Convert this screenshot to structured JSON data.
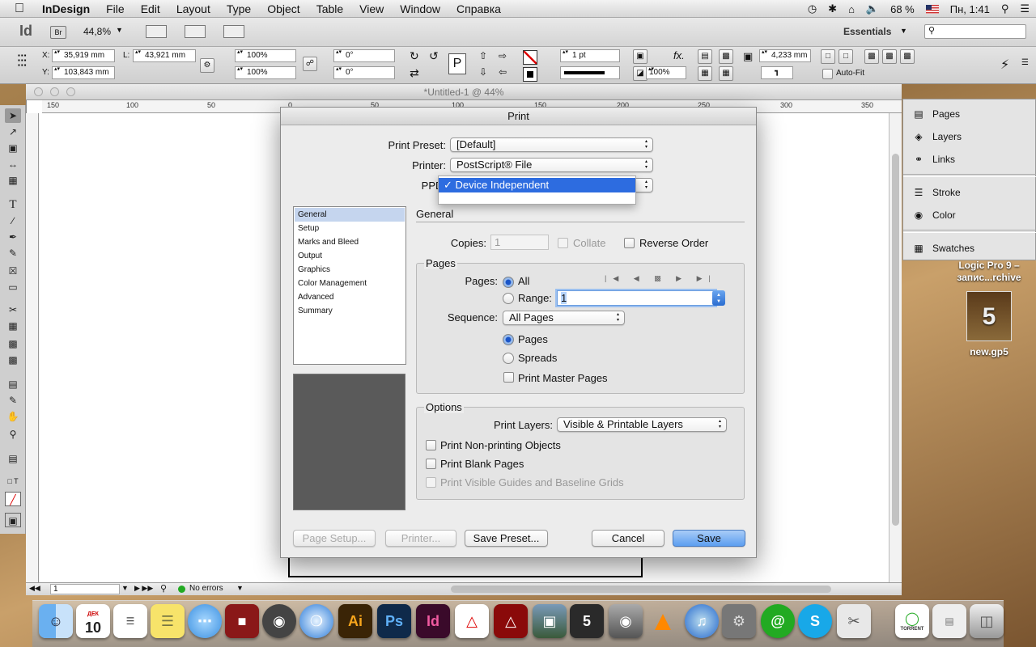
{
  "menubar": {
    "apple": "",
    "app": "InDesign",
    "items": [
      "File",
      "Edit",
      "Layout",
      "Type",
      "Object",
      "Table",
      "View",
      "Window",
      "Справка"
    ],
    "battery": "68 %",
    "clock": "Пн, 1:41"
  },
  "appbar": {
    "logo": "Id",
    "bridge": "Br",
    "zoom": "44,8%",
    "workspace": "Essentials",
    "search_placeholder": ""
  },
  "control": {
    "x": "35,919 mm",
    "y": "103,843 mm",
    "w_label": "L:",
    "w": "43,921 mm",
    "x_label": "X:",
    "y_label": "Y:",
    "scale_x": "100%",
    "scale_y": "100%",
    "rotate": "0°",
    "shear": "0°",
    "stroke_weight": "1 pt",
    "opacity": "100%",
    "offset": "4,233 mm",
    "autofit": "Auto-Fit"
  },
  "document": {
    "title": "*Untitled-1 @ 44%",
    "ruler_marks": [
      "150",
      "100",
      "50",
      "0",
      "50",
      "100",
      "150",
      "200",
      "250",
      "300",
      "350"
    ],
    "status_page": "1",
    "status_errors": "No errors"
  },
  "panels": {
    "items": [
      "Pages",
      "Layers",
      "Links",
      "Stroke",
      "Color",
      "Swatches"
    ]
  },
  "desktop": {
    "icon1": "Logic Pro 9 –\nзапис...rchive",
    "icon2": "new.gp5"
  },
  "dialog": {
    "title": "Print",
    "preset_label": "Print Preset:",
    "preset": "[Default]",
    "printer_label": "Printer:",
    "printer": "PostScript® File",
    "ppd_label": "PPD:",
    "ppd_selected": "✓ Device Independent",
    "categories": [
      "General",
      "Setup",
      "Marks and Bleed",
      "Output",
      "Graphics",
      "Color Management",
      "Advanced",
      "Summary"
    ],
    "section_title": "General",
    "copies_label": "Copies:",
    "copies": "1",
    "collate": "Collate",
    "reverse": "Reverse Order",
    "pages_group": "Pages",
    "pages_label": "Pages:",
    "all": "All",
    "range": "Range:",
    "range_value": "1",
    "sequence_label": "Sequence:",
    "sequence": "All Pages",
    "opt_pages": "Pages",
    "opt_spreads": "Spreads",
    "master": "Print Master Pages",
    "options_group": "Options",
    "layers_label": "Print Layers:",
    "layers": "Visible & Printable Layers",
    "nonprint": "Print Non-printing Objects",
    "blank": "Print Blank Pages",
    "guides": "Print Visible Guides and Baseline Grids",
    "btn_page_setup": "Page Setup...",
    "btn_printer": "Printer...",
    "btn_save_preset": "Save Preset...",
    "btn_cancel": "Cancel",
    "btn_save": "Save"
  },
  "dock": {
    "apps": [
      "Finder",
      "Calendar",
      "Reminders",
      "Stickies",
      "Messages",
      "Photo Booth",
      "Camera",
      "Safari",
      "Ai",
      "Ps",
      "Id",
      "Acrobat",
      "Reader",
      "iPhoto",
      "Guitar Pro",
      "Disk Utility",
      "VLC",
      "iTunes",
      "System Preferences",
      "@",
      "S",
      "Scissors",
      "Torrent",
      "Preview",
      "Trash"
    ],
    "calendar_day": "10",
    "calendar_month": "ДЕК",
    "torrent_label": "TORRENT"
  }
}
